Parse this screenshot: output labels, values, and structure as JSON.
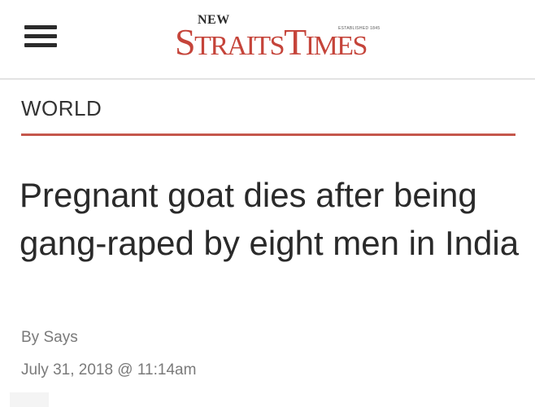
{
  "header": {
    "logo": {
      "line1": "NEW",
      "established": "ESTABLISHED 1845",
      "main": "STRAITS TIMES"
    }
  },
  "article": {
    "section": "WORLD",
    "headline": "Pregnant goat dies after being gang-raped by eight men in India",
    "byline": "By Says",
    "date": "July 31, 2018 @ 11:14am"
  },
  "colors": {
    "brand": "#c5443a",
    "rule": "#c5574c",
    "text": "#2a2a2a",
    "meta": "#7a7a7a"
  }
}
